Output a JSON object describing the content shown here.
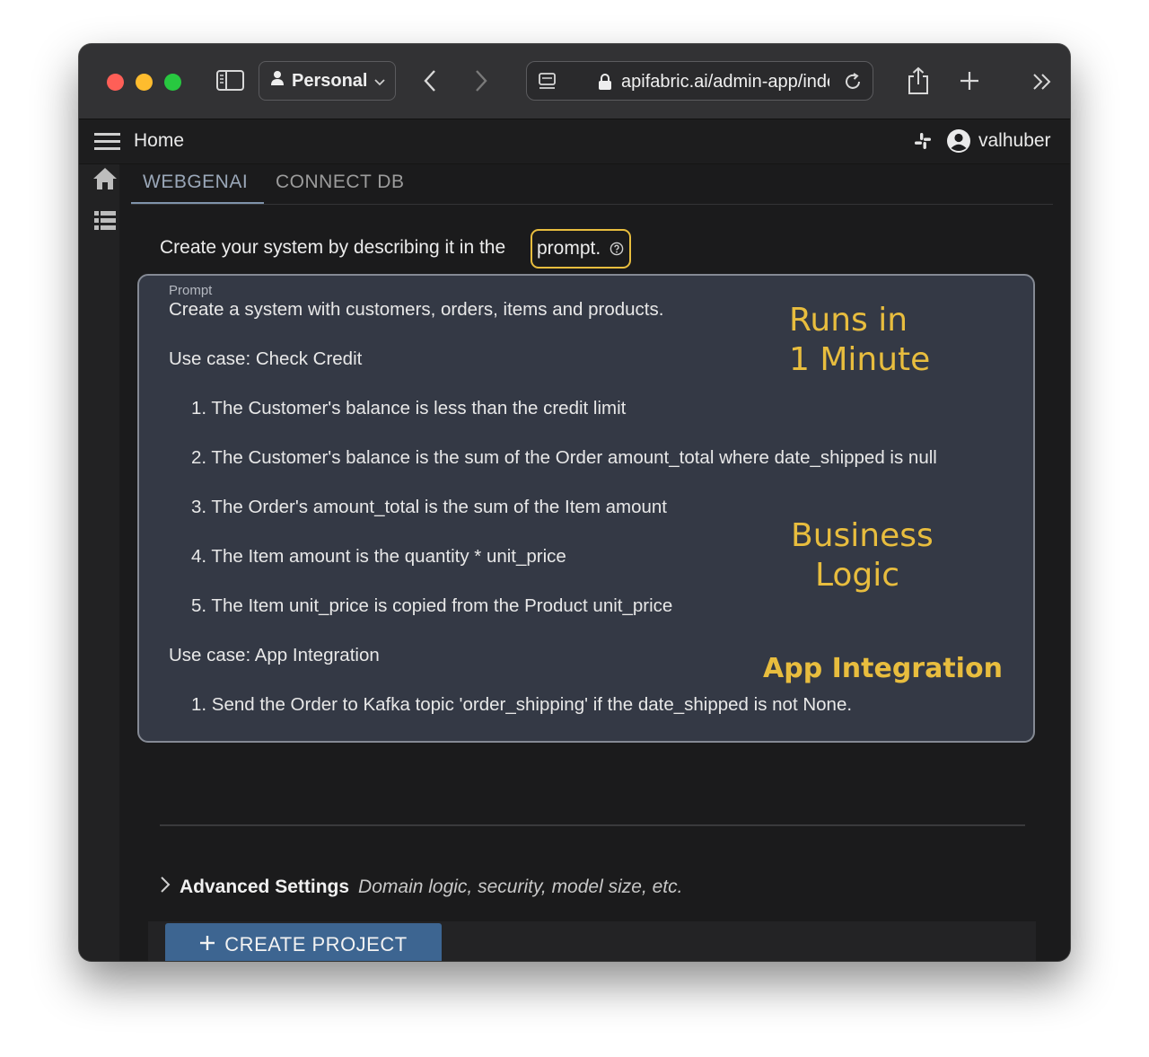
{
  "browser": {
    "profile_label": "Personal",
    "url": "apifabric.ai/admin-app/index.html"
  },
  "app": {
    "title": "Home",
    "user_name": "valhuber"
  },
  "tabs": [
    {
      "label": "WEBGENAI",
      "active": true
    },
    {
      "label": "CONNECT DB",
      "active": false
    }
  ],
  "intro": {
    "text": "Create your system by describing it in the",
    "highlight": "prompt."
  },
  "prompt": {
    "label": "Prompt",
    "lines": [
      "Create a system with customers, orders, items and products.",
      "Use case: Check Credit",
      "1. The Customer's balance is less than the credit limit",
      "2. The Customer's balance is the sum of the Order amount_total where date_shipped is null",
      "3. The Order's amount_total is the sum of the Item amount",
      "4. The Item amount is the quantity * unit_price",
      "5. The Item unit_price is copied from the Product unit_price",
      "Use case: App Integration",
      "1. Send the Order to Kafka topic 'order_shipping' if the date_shipped is not None."
    ]
  },
  "annotations": {
    "runs_line1": "Runs in",
    "runs_line2": "1 Minute",
    "business_line1": "Business",
    "business_line2": "Logic",
    "integration": "App Integration",
    "color": "#e8bd3e"
  },
  "advanced": {
    "title": "Advanced Settings",
    "description": "Domain logic, security, model size, etc."
  },
  "create_button": {
    "label": "CREATE PROJECT"
  },
  "colors": {
    "accent": "#3d6591",
    "highlight_border": "#e8bd3e"
  }
}
